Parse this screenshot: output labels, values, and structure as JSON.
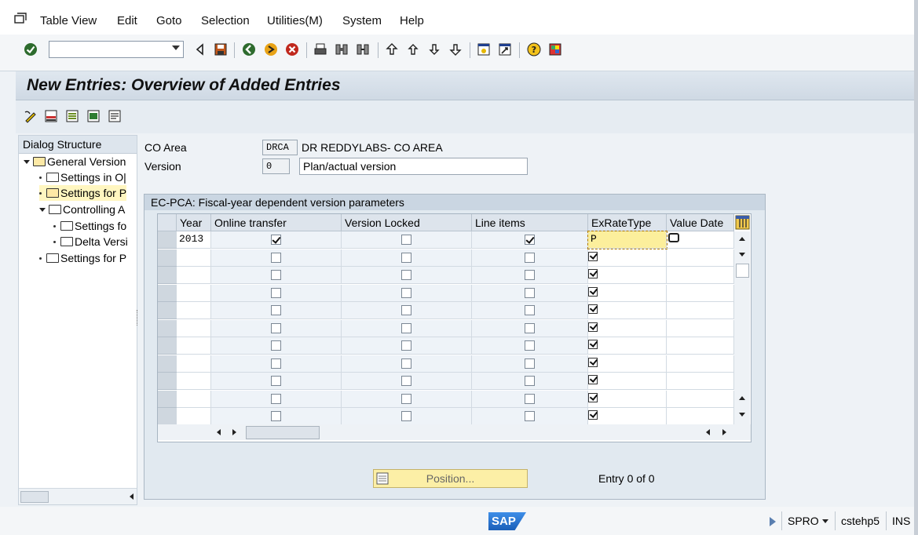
{
  "menu": {
    "items": [
      "Table View",
      "Edit",
      "Goto",
      "Selection",
      "Utilities(M)",
      "System",
      "Help"
    ]
  },
  "toolbar": {
    "command_value": "",
    "icons": [
      "enter-icon",
      "back-arrow-icon",
      "save-icon",
      "back-icon",
      "exit-icon",
      "cancel-icon",
      "print-icon",
      "find-icon",
      "find-next-icon",
      "first-page-icon",
      "previous-page-icon",
      "next-page-icon",
      "last-page-icon",
      "create-session-icon",
      "shortcut-icon",
      "help-icon",
      "customize-layout-icon"
    ]
  },
  "title": "New Entries: Overview of Added Entries",
  "dialog_structure": {
    "header": "Dialog Structure",
    "items": [
      {
        "label": "General Version",
        "level": 0,
        "expanded": true
      },
      {
        "label": "Settings in O|",
        "level": 1,
        "expanded": false
      },
      {
        "label": "Settings for P",
        "level": 1,
        "expanded": false,
        "selected": true
      },
      {
        "label": "Controlling A",
        "level": 1,
        "expanded": true
      },
      {
        "label": "Settings fo",
        "level": 2,
        "expanded": false
      },
      {
        "label": "Delta Versi",
        "level": 2,
        "expanded": false
      },
      {
        "label": "Settings for P",
        "level": 0,
        "expanded": false
      }
    ]
  },
  "header_fields": {
    "co_area_label": "CO Area",
    "co_area_value": "DRCA",
    "co_area_text": "DR REDDYLABS- CO AREA",
    "version_label": "Version",
    "version_value": "0",
    "version_text": "Plan/actual version"
  },
  "table": {
    "group_title": "EC-PCA: Fiscal-year dependent version parameters",
    "columns": [
      "Year",
      "Online transfer",
      "Version Locked",
      "Line items",
      "ExRateType",
      "Value Date"
    ],
    "rows": [
      {
        "year": "2013",
        "online_transfer": true,
        "version_locked": false,
        "line_items": true,
        "exratetype": "P",
        "value_date": ""
      },
      {
        "year": "",
        "online_transfer": false,
        "version_locked": false,
        "line_items": false,
        "exratetype": "",
        "value_date": ""
      },
      {
        "year": "",
        "online_transfer": false,
        "version_locked": false,
        "line_items": false,
        "exratetype": "",
        "value_date": ""
      },
      {
        "year": "",
        "online_transfer": false,
        "version_locked": false,
        "line_items": false,
        "exratetype": "",
        "value_date": ""
      },
      {
        "year": "",
        "online_transfer": false,
        "version_locked": false,
        "line_items": false,
        "exratetype": "",
        "value_date": ""
      },
      {
        "year": "",
        "online_transfer": false,
        "version_locked": false,
        "line_items": false,
        "exratetype": "",
        "value_date": ""
      },
      {
        "year": "",
        "online_transfer": false,
        "version_locked": false,
        "line_items": false,
        "exratetype": "",
        "value_date": ""
      },
      {
        "year": "",
        "online_transfer": false,
        "version_locked": false,
        "line_items": false,
        "exratetype": "",
        "value_date": ""
      },
      {
        "year": "",
        "online_transfer": false,
        "version_locked": false,
        "line_items": false,
        "exratetype": "",
        "value_date": ""
      },
      {
        "year": "",
        "online_transfer": false,
        "version_locked": false,
        "line_items": false,
        "exratetype": "",
        "value_date": ""
      },
      {
        "year": "",
        "online_transfer": false,
        "version_locked": false,
        "line_items": false,
        "exratetype": "",
        "value_date": ""
      }
    ]
  },
  "position_button": "Position...",
  "entry_count": "Entry 0 of 0",
  "status": {
    "logo": "SAP",
    "transaction": "SPRO",
    "server": "cstehp5",
    "mode": "INS"
  },
  "colors": {
    "selected_cell": "#fcef9c",
    "title_bg": "#d6dfe8",
    "group_bg": "#e1e9f0"
  }
}
